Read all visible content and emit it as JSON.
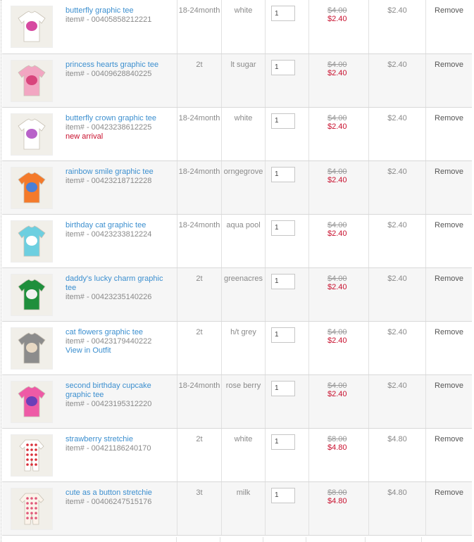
{
  "cart": {
    "items": [
      {
        "name": "butterfly graphic tee",
        "sku": "item# - 00405858212221",
        "size": "18-24month",
        "color": "white",
        "qty": "1",
        "old_price": "$4.00",
        "price": "$2.40",
        "total": "$2.40",
        "remove": "Remove",
        "extra": "",
        "extra_link": "",
        "shirt": "#ffffff",
        "art": "#d64aa0",
        "kind": "tee"
      },
      {
        "name": "princess hearts graphic tee",
        "sku": "item# - 00409628840225",
        "size": "2t",
        "color": "lt sugar",
        "qty": "1",
        "old_price": "$4.00",
        "price": "$2.40",
        "total": "$2.40",
        "remove": "Remove",
        "extra": "",
        "extra_link": "",
        "shirt": "#f2a6c2",
        "art": "#d8457c",
        "kind": "tee"
      },
      {
        "name": "butterfly crown graphic tee",
        "sku": "item# - 00423238612225",
        "size": "18-24month",
        "color": "white",
        "qty": "1",
        "old_price": "$4.00",
        "price": "$2.40",
        "total": "$2.40",
        "remove": "Remove",
        "extra": "new arrival",
        "extra_link": "",
        "shirt": "#ffffff",
        "art": "#b862c9",
        "kind": "tee"
      },
      {
        "name": "rainbow smile graphic tee",
        "sku": "item# - 00423218712228",
        "size": "18-24month",
        "color": "orngegrove",
        "qty": "1",
        "old_price": "$4.00",
        "price": "$2.40",
        "total": "$2.40",
        "remove": "Remove",
        "extra": "",
        "extra_link": "",
        "shirt": "#f47a2a",
        "art": "#4a7fd6",
        "kind": "tee"
      },
      {
        "name": "birthday cat graphic tee",
        "sku": "item# - 00423233812224",
        "size": "18-24month",
        "color": "aqua pool",
        "qty": "1",
        "old_price": "$4.00",
        "price": "$2.40",
        "total": "$2.40",
        "remove": "Remove",
        "extra": "",
        "extra_link": "",
        "shirt": "#6dcfe0",
        "art": "#ffffff",
        "kind": "tee"
      },
      {
        "name": "daddy's lucky charm graphic tee",
        "sku": "item# - 00423235140226",
        "size": "2t",
        "color": "greenacres",
        "qty": "1",
        "old_price": "$4.00",
        "price": "$2.40",
        "total": "$2.40",
        "remove": "Remove",
        "extra": "",
        "extra_link": "",
        "shirt": "#1f8f3c",
        "art": "#f2f2f2",
        "kind": "tee"
      },
      {
        "name": "cat flowers graphic tee",
        "sku": "item# - 00423179440222",
        "size": "2t",
        "color": "h/t grey",
        "qty": "1",
        "old_price": "$4.00",
        "price": "$2.40",
        "total": "$2.40",
        "remove": "Remove",
        "extra": "",
        "extra_link": "View in Outfit",
        "shirt": "#8c8c8c",
        "art": "#e8d9c4",
        "kind": "tee"
      },
      {
        "name": "second birthday cupcake graphic tee",
        "sku": "item# - 00423195312220",
        "size": "18-24month",
        "color": "rose berry",
        "qty": "1",
        "old_price": "$4.00",
        "price": "$2.40",
        "total": "$2.40",
        "remove": "Remove",
        "extra": "",
        "extra_link": "",
        "shirt": "#ee5aa6",
        "art": "#6a3fb8",
        "kind": "tee"
      },
      {
        "name": "strawberry stretchie",
        "sku": "item# - 00421186240170",
        "size": "2t",
        "color": "white",
        "qty": "1",
        "old_price": "$8.00",
        "price": "$4.80",
        "total": "$4.80",
        "remove": "Remove",
        "extra": "",
        "extra_link": "",
        "shirt": "#ffffff",
        "art": "#d9303a",
        "kind": "sleeper"
      },
      {
        "name": "cute as a button stretchie",
        "sku": "item# - 00406247515176",
        "size": "3t",
        "color": "milk",
        "qty": "1",
        "old_price": "$8.00",
        "price": "$4.80",
        "total": "$4.80",
        "remove": "Remove",
        "extra": "",
        "extra_link": "",
        "shirt": "#fbf3ea",
        "art": "#e0587a",
        "kind": "sleeper"
      }
    ]
  }
}
